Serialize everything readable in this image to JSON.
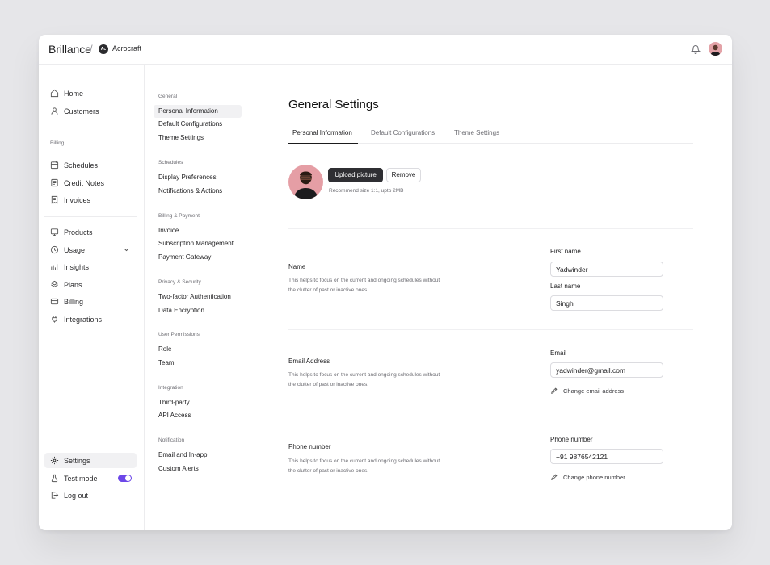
{
  "app": {
    "brand": "Brillance",
    "separator": "/",
    "org_initials": "Ac",
    "org_name": "Acrocraft"
  },
  "sidebar": {
    "top_items": [
      {
        "label": "Home",
        "icon": "home-icon"
      },
      {
        "label": "Customers",
        "icon": "user-icon"
      }
    ],
    "billing_label": "Billing",
    "billing_items": [
      {
        "label": "Schedules",
        "icon": "calendar-icon"
      },
      {
        "label": "Credit Notes",
        "icon": "note-icon"
      },
      {
        "label": "Invoices",
        "icon": "invoice-icon"
      }
    ],
    "product_items": [
      {
        "label": "Products",
        "icon": "box-icon"
      },
      {
        "label": "Usage",
        "icon": "usage-icon"
      },
      {
        "label": "Insights",
        "icon": "chart-icon"
      },
      {
        "label": "Plans",
        "icon": "layers-icon"
      },
      {
        "label": "Billing",
        "icon": "card-icon"
      },
      {
        "label": "Integrations",
        "icon": "plug-icon"
      }
    ],
    "bottom_items": [
      {
        "label": "Settings",
        "icon": "gear-icon"
      },
      {
        "label": "Test mode",
        "icon": "flask-icon"
      },
      {
        "label": "Log out",
        "icon": "logout-icon"
      }
    ],
    "test_mode_on": true
  },
  "subnav": {
    "general": {
      "heading": "General",
      "items": [
        "Personal Information",
        "Default Configurations",
        "Theme Settings"
      ]
    },
    "schedules": {
      "heading": "Schedules",
      "items": [
        "Display Preferences",
        "Notifications & Actions"
      ]
    },
    "billing": {
      "heading": "Billing & Payment",
      "items": [
        "Invoice",
        "Subscription Management",
        "Payment Gateway"
      ]
    },
    "privacy": {
      "heading": "Privacy & Security",
      "items": [
        "Two-factor Authentication",
        "Data Encryption"
      ]
    },
    "permissions": {
      "heading": "User Permissions",
      "items": [
        "Role",
        "Team"
      ]
    },
    "integration": {
      "heading": "Integration",
      "items": [
        "Third-party",
        "API Access"
      ]
    },
    "notification": {
      "heading": "Notification",
      "items": [
        "Email and In-app",
        "Custom Alerts"
      ]
    }
  },
  "main": {
    "title": "General Settings",
    "tabs": [
      "Personal Information",
      "Default Configurations",
      "Theme Settings"
    ],
    "upload_label": "Upload picture",
    "remove_label": "Remove",
    "upload_hint": "Recommend size 1:1, upto 2MB",
    "name_section": {
      "title": "Name",
      "desc": "This helps to focus on the current and ongoing schedules without the clutter of past or inactive ones.",
      "first_label": "First name",
      "first_value": "Yadwinder",
      "last_label": "Last name",
      "last_value": "Singh"
    },
    "email_section": {
      "title": "Email Address",
      "desc": "This helps to focus on the current and ongoing schedules without the clutter of past or inactive ones.",
      "label": "Email",
      "value": "yadwinder@gmail.com",
      "change": "Change email address"
    },
    "phone_section": {
      "title": "Phone number",
      "desc": "This helps to focus on the current and ongoing schedules without the clutter of past or inactive ones.",
      "label": "Phone number",
      "value": "+91 9876542121",
      "change": "Change phone number"
    }
  },
  "colors": {
    "accent": "#6c47e8",
    "primary_button": "#2f2f33",
    "avatar_bg": "#e59ea5"
  }
}
